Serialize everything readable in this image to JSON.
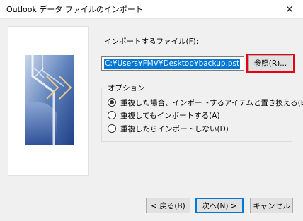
{
  "window": {
    "title": "Outlook データ ファイルのインポート",
    "close_glyph": "✕"
  },
  "import_file": {
    "label": "インポートするファイル(F):",
    "path": "C:¥Users¥FMV¥Desktop¥backup.pst",
    "browse_label": "参照(R)..."
  },
  "options": {
    "legend": "オプション",
    "items": [
      {
        "label": "重複した場合、インポートするアイテムと置き換える(E)",
        "selected": true
      },
      {
        "label": "重複してもインポートする(A)",
        "selected": false
      },
      {
        "label": "重複したらインポートしない(D)",
        "selected": false
      }
    ]
  },
  "buttons": {
    "back": "< 戻る(B)",
    "next": "次へ(N) >",
    "cancel": "キャンセル"
  },
  "colors": {
    "highlight_border": "#e60012",
    "selection": "#0078d7"
  }
}
